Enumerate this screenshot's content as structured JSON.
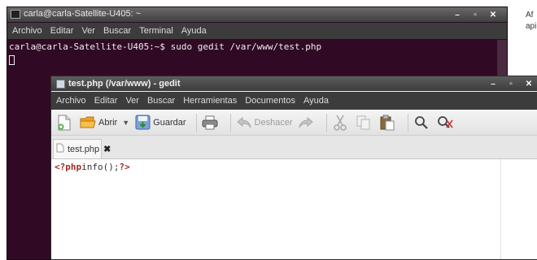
{
  "background": {
    "text_line1": "Af",
    "text_line2": "api"
  },
  "terminal": {
    "title": "carla@carla-Satellite-U405: ~",
    "menu": [
      "Archivo",
      "Editar",
      "Ver",
      "Buscar",
      "Terminal",
      "Ayuda"
    ],
    "prompt_line": "carla@carla-Satellite-U405:~$ sudo gedit /var/www/test.php",
    "colors": {
      "background": "#300a24",
      "text": "#eeeeee"
    }
  },
  "gedit": {
    "title": "test.php (/var/www) - gedit",
    "menu": [
      "Archivo",
      "Editar",
      "Ver",
      "Buscar",
      "Herramientas",
      "Documentos",
      "Ayuda"
    ],
    "toolbar": {
      "open_label": "Abrir",
      "save_label": "Guardar",
      "undo_label": "Deshacer",
      "icons": [
        "new-document-icon",
        "open-folder-icon",
        "dropdown-arrow-icon",
        "save-icon",
        "print-icon",
        "undo-icon",
        "redo-icon",
        "cut-icon",
        "copy-icon",
        "paste-icon",
        "find-icon",
        "find-replace-icon"
      ]
    },
    "tab": {
      "label": "test.php"
    },
    "code": {
      "open_tag": "<?php",
      "body": "info();",
      "close_tag": "?>"
    }
  }
}
